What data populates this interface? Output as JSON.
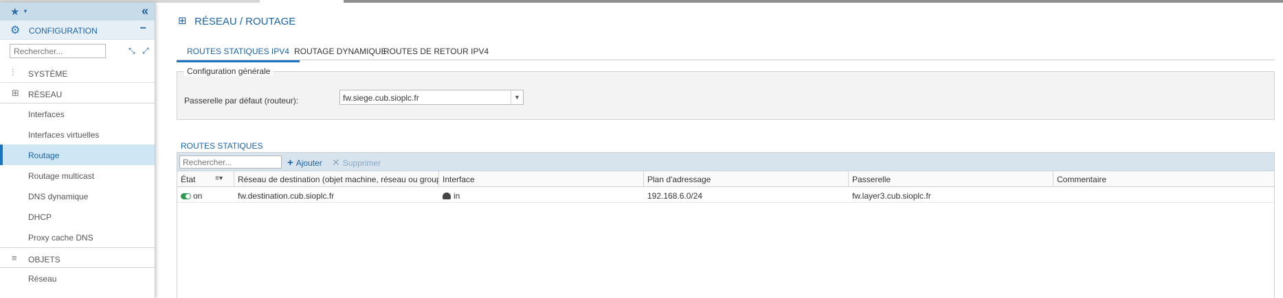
{
  "sidebar": {
    "favorites_icon": "star-icon",
    "collapse_icon": "double-chevron-left-icon",
    "section_label": "CONFIGURATION",
    "search_placeholder": "Rechercher...",
    "groups": [
      {
        "label": "SYSTÈME",
        "icon": "sliders-icon"
      },
      {
        "label": "RÉSEAU",
        "icon": "network-icon"
      },
      {
        "label": "OBJETS",
        "icon": "database-icon"
      }
    ],
    "network_items": [
      {
        "label": "Interfaces"
      },
      {
        "label": "Interfaces virtuelles"
      },
      {
        "label": "Routage",
        "active": true
      },
      {
        "label": "Routage multicast"
      },
      {
        "label": "DNS dynamique"
      },
      {
        "label": "DHCP"
      },
      {
        "label": "Proxy cache DNS"
      }
    ],
    "objects_items": [
      {
        "label": "Réseau"
      }
    ]
  },
  "page": {
    "title": "RÉSEAU / ROUTAGE",
    "tabs": [
      {
        "label": "ROUTES STATIQUES IPV4",
        "active": true
      },
      {
        "label": "ROUTAGE DYNAMIQUE"
      },
      {
        "label": "ROUTES DE RETOUR IPV4"
      }
    ]
  },
  "general_config": {
    "legend": "Configuration générale",
    "gateway_label": "Passerelle par défaut (routeur):",
    "gateway_value": "fw.siege.cub.sioplc.fr"
  },
  "static_routes": {
    "title": "ROUTES STATIQUES",
    "search_placeholder": "Rechercher...",
    "add_label": "Ajouter",
    "delete_label": "Supprimer",
    "columns": [
      "État",
      "Réseau de destination (objet machine, réseau ou groupe)",
      "Interface",
      "Plan d'adressage",
      "Passerelle",
      "Commentaire"
    ],
    "rows": [
      {
        "state": "on",
        "destination": "fw.destination.cub.sioplc.fr",
        "interface": "in",
        "addressing": "192.168.6.0/24",
        "gateway": "fw.layer3.cub.sioplc.fr",
        "comment": ""
      }
    ]
  },
  "colors": {
    "accent": "#1a63a5",
    "toolbar": "#d7e4ee",
    "active_item": "#cfe6f5",
    "toggle_on": "#2e9b4e"
  }
}
